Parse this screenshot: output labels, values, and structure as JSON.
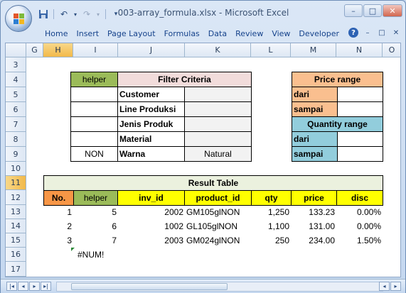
{
  "window": {
    "title": "003-array_formula.xlsx - Microsoft Excel",
    "controls": [
      "–",
      "□",
      "✕"
    ]
  },
  "qat": {
    "icons": [
      "save-icon",
      "undo-icon",
      "redo-icon",
      "customize-icon"
    ]
  },
  "ribbon": {
    "tabs": [
      "Home",
      "Insert",
      "Page Layout",
      "Formulas",
      "Data",
      "Review",
      "View",
      "Developer"
    ]
  },
  "grid": {
    "columns": [
      "G",
      "H",
      "I",
      "J",
      "K",
      "L",
      "M",
      "N",
      "O"
    ],
    "rows": [
      "3",
      "4",
      "5",
      "6",
      "7",
      "8",
      "9",
      "10",
      "11",
      "12",
      "13",
      "14",
      "15",
      "16",
      "17"
    ],
    "selected_column": "H",
    "selected_row": "11"
  },
  "filter": {
    "helper_header": "helper",
    "criteria_header": "Filter Criteria",
    "labels": [
      "Customer",
      "Line Produksi",
      "Jenis Produk",
      "Material",
      "Warna"
    ],
    "values": [
      "",
      "",
      "",
      "",
      "Natural"
    ],
    "helper_values": [
      "",
      "",
      "",
      "",
      "NON"
    ]
  },
  "price": {
    "header": "Price range",
    "from": "dari",
    "to": "sampai"
  },
  "quantity": {
    "header": "Quantity range",
    "from": "dari",
    "to": "sampai"
  },
  "result": {
    "title": "Result Table",
    "headers": [
      "No.",
      "helper",
      "inv_id",
      "product_id",
      "qty",
      "price",
      "disc"
    ],
    "rows": [
      [
        "1",
        "5",
        "2002",
        "GM105glNON",
        "1,250",
        "133.23",
        "0.00%"
      ],
      [
        "2",
        "6",
        "1002",
        "GL105glNON",
        "1,100",
        "131.00",
        "0.00%"
      ],
      [
        "3",
        "7",
        "2003",
        "GM024glNON",
        "250",
        "234.00",
        "1.50%"
      ]
    ],
    "error": "#NUM!"
  },
  "colors": {
    "helper_green": "#9bbb59",
    "criteria_pink": "#f2dcdb",
    "price_orange": "#fabf8f",
    "quantity_blue": "#92cddc",
    "result_title": "#ebf1de",
    "yellow": "#ffff00",
    "number_orange": "#f79646"
  }
}
